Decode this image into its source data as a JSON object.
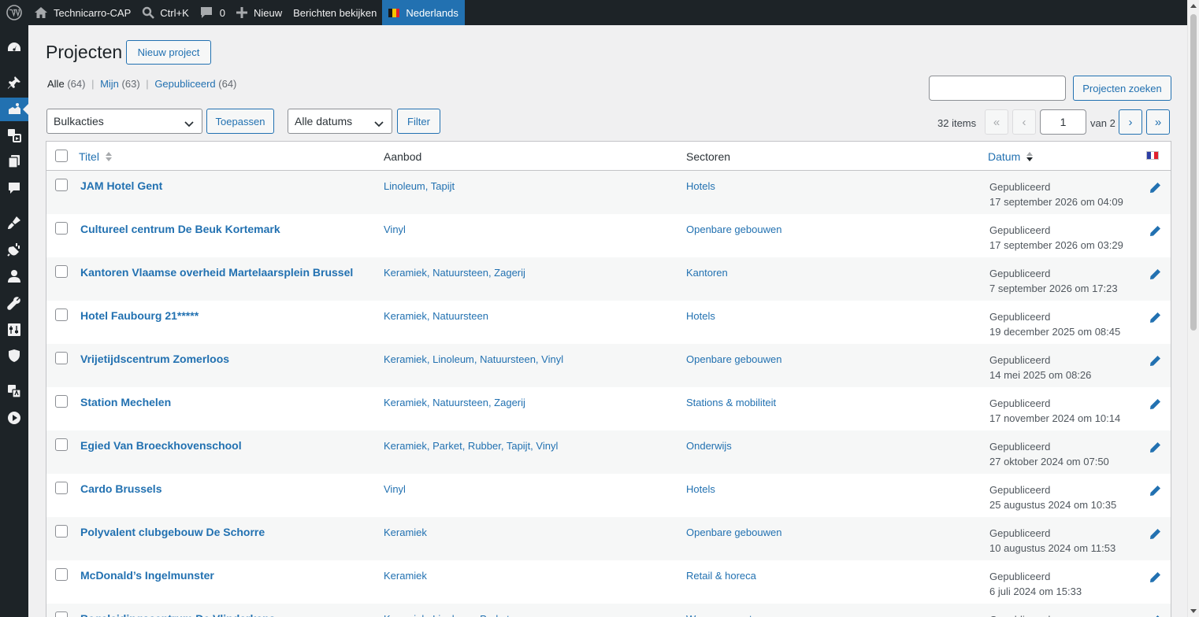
{
  "adminbar": {
    "site_name": "Technicarro-CAP",
    "search_shortcut": "Ctrl+K",
    "comments_count": "0",
    "new_label": "Nieuw",
    "view_posts_label": "Berichten bekijken",
    "language_label": "Nederlands"
  },
  "page": {
    "title": "Projecten",
    "new_button": "Nieuw project"
  },
  "views": [
    {
      "label": "Alle",
      "count": "(64)"
    },
    {
      "label": "Mijn",
      "count": "(63)"
    },
    {
      "label": "Gepubliceerd",
      "count": "(64)"
    }
  ],
  "search": {
    "button": "Projecten zoeken",
    "value": ""
  },
  "filters": {
    "bulk_select": "Bulkacties",
    "apply_button": "Toepassen",
    "date_select": "Alle datums",
    "filter_button": "Filter"
  },
  "pagination": {
    "items": "32 items",
    "first": "«",
    "prev": "‹",
    "current": "1",
    "of": "van 2",
    "next": "›",
    "last": "»"
  },
  "columns": {
    "title": "Titel",
    "offer": "Aanbod",
    "sectors": "Sectoren",
    "date": "Datum"
  },
  "rows": [
    {
      "title": "JAM Hotel Gent",
      "offer": "Linoleum, Tapijt",
      "sector": "Hotels",
      "status": "Gepubliceerd",
      "date": "17 september 2026 om 04:09"
    },
    {
      "title": "Cultureel centrum De Beuk Kortemark",
      "offer": "Vinyl",
      "sector": "Openbare gebouwen",
      "status": "Gepubliceerd",
      "date": "17 september 2026 om 03:29"
    },
    {
      "title": "Kantoren Vlaamse overheid Martelaarsplein Brussel",
      "offer": "Keramiek, Natuursteen, Zagerij",
      "sector": "Kantoren",
      "status": "Gepubliceerd",
      "date": "7 september 2026 om 17:23"
    },
    {
      "title": "Hotel Faubourg 21*****",
      "offer": "Keramiek, Natuursteen",
      "sector": "Hotels",
      "status": "Gepubliceerd",
      "date": "19 december 2025 om 08:45"
    },
    {
      "title": "Vrijetijdscentrum Zomerloos",
      "offer": "Keramiek, Linoleum, Natuursteen, Vinyl",
      "sector": "Openbare gebouwen",
      "status": "Gepubliceerd",
      "date": "14 mei 2025 om 08:26"
    },
    {
      "title": "Station Mechelen",
      "offer": "Keramiek, Natuursteen, Zagerij",
      "sector": "Stations & mobiliteit",
      "status": "Gepubliceerd",
      "date": "17 november 2024 om 10:14"
    },
    {
      "title": "Egied Van Broeckhovenschool",
      "offer": "Keramiek, Parket, Rubber, Tapijt, Vinyl",
      "sector": "Onderwijs",
      "status": "Gepubliceerd",
      "date": "27 oktober 2024 om 07:50"
    },
    {
      "title": "Cardo Brussels",
      "offer": "Vinyl",
      "sector": "Hotels",
      "status": "Gepubliceerd",
      "date": "25 augustus 2024 om 10:35"
    },
    {
      "title": "Polyvalent clubgebouw De Schorre",
      "offer": "Keramiek",
      "sector": "Openbare gebouwen",
      "status": "Gepubliceerd",
      "date": "10 augustus 2024 om 11:53"
    },
    {
      "title": "McDonald’s Ingelmunster",
      "offer": "Keramiek",
      "sector": "Retail & horeca",
      "status": "Gepubliceerd",
      "date": "6 juli 2024 om 15:33"
    },
    {
      "title": "Begeleidingscentrum De Vlinderkens",
      "offer": "Keramiek, Linoleum, Parket",
      "sector": "Woonzorgcentra",
      "status": "Gepubliceerd",
      "date": ""
    }
  ]
}
